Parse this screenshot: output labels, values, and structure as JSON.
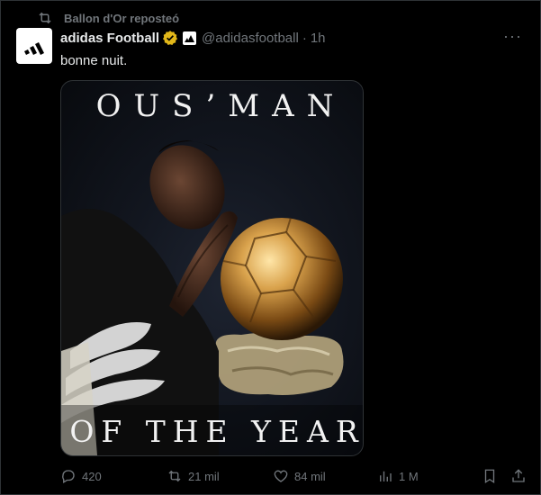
{
  "repost": {
    "label": "Ballon d'Or reposteó"
  },
  "tweet": {
    "author_name": "adidas Football",
    "handle": "@adidasfootball",
    "separator": "·",
    "time": "1h",
    "text": "bonne nuit.",
    "more": "···"
  },
  "media": {
    "top_text": "OUS’MAN",
    "bottom_text": "OF THE YEAR"
  },
  "actions": {
    "replies": "420",
    "reposts": "21 mil",
    "likes": "84 mil",
    "views": "1 M"
  },
  "colors": {
    "background": "#000000",
    "muted": "#71767b",
    "text": "#e7e9ea",
    "verified_gold": "#e2b719"
  },
  "icons": {
    "repost": "repost-icon",
    "verified": "verified-badge-icon",
    "affiliate": "affiliate-badge-icon",
    "reply": "reply-icon",
    "like": "heart-icon",
    "views": "bar-chart-icon",
    "bookmark": "bookmark-icon",
    "share": "share-icon"
  }
}
